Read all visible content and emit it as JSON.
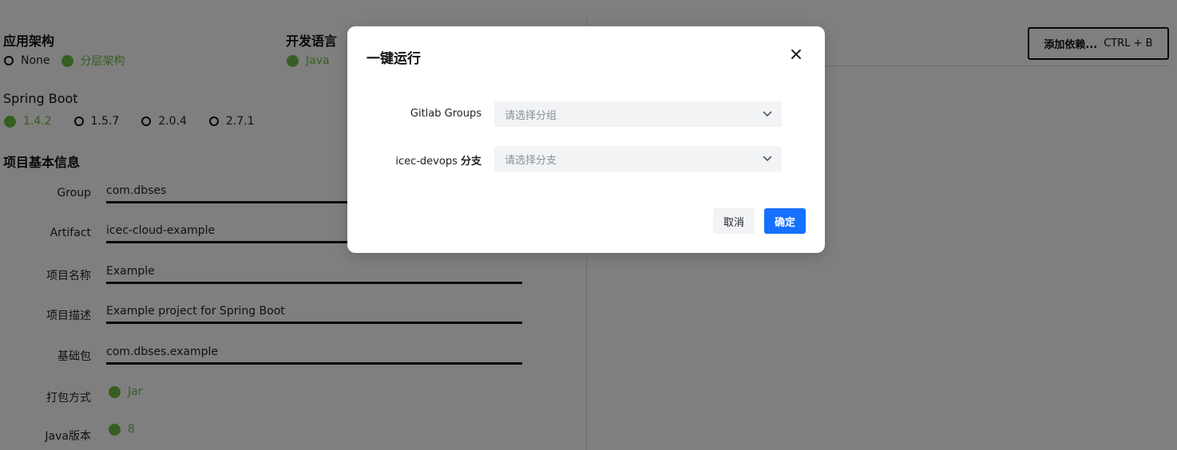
{
  "left_panel": {
    "app_arch": {
      "title": "应用架构",
      "options": [
        "None",
        "分层架构"
      ],
      "selected": "分层架构"
    },
    "dev_lang": {
      "title": "开发语言",
      "options": [
        "Java"
      ],
      "selected": "Java"
    },
    "spring_boot": {
      "title": "Spring Boot",
      "options": [
        "1.4.2",
        "1.5.7",
        "2.0.4",
        "2.7.1"
      ],
      "selected": "1.4.2"
    },
    "project_info": {
      "title": "项目基本信息",
      "fields": [
        {
          "label": "Group",
          "value": "com.dbses"
        },
        {
          "label": "Artifact",
          "value": "icec-cloud-example"
        },
        {
          "label": "项目名称",
          "value": "Example"
        },
        {
          "label": "项目描述",
          "value": "Example project for Spring Boot"
        },
        {
          "label": "基础包",
          "value": "com.dbses.example"
        }
      ],
      "packaging": {
        "label": "打包方式",
        "selected": "Jar"
      },
      "java_version": {
        "label": "Java版本",
        "selected": "8"
      }
    }
  },
  "right_panel": {
    "add_dependency_button": {
      "label": "添加依赖...",
      "shortcut": "CTRL + B"
    }
  },
  "modal": {
    "title": "一键运行",
    "rows": [
      {
        "label": "Gitlab Groups",
        "label_bold": "",
        "placeholder": "请选择分组"
      },
      {
        "label": "icec-devops ",
        "label_bold": "分支",
        "placeholder": "请选择分支"
      }
    ],
    "cancel_label": "取消",
    "ok_label": "确定"
  },
  "colors": {
    "accent_green": "#6fbd45",
    "primary_blue": "#1671ff",
    "overlay": "rgba(0,0,0,0.5)",
    "select_bg": "#f2f3f5"
  },
  "icons": [
    "close-icon",
    "chevron-down-icon"
  ]
}
